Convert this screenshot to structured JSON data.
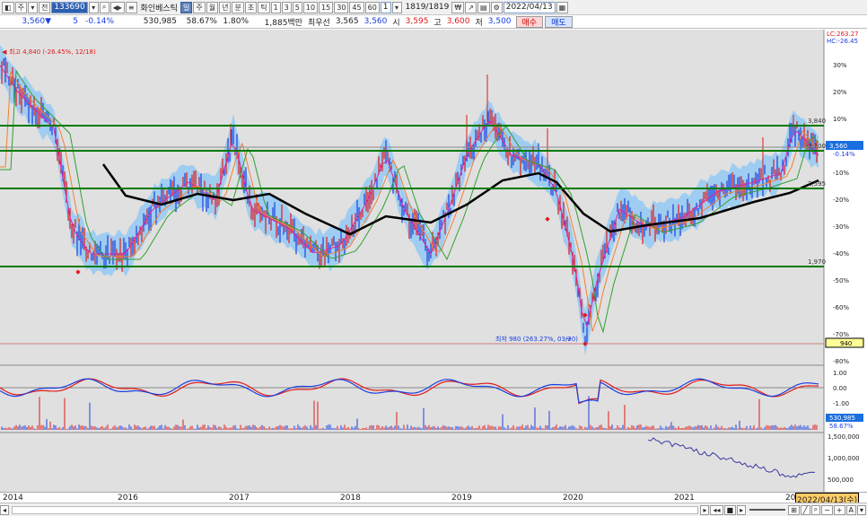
{
  "toolbar1": {
    "btn_a": "주",
    "btn_b": "전",
    "code": "133690",
    "name": "화인베스틱",
    "period_sel": "일",
    "period_week": "주",
    "period_month": "월",
    "period_year": "년",
    "period_min": "분",
    "period_sec": "초",
    "period_tick": "틱",
    "intervals": [
      "1",
      "3",
      "5",
      "10",
      "15",
      "30",
      "45",
      "60"
    ],
    "count": "1",
    "count2": "1819/1819",
    "date": "2022/04/13"
  },
  "quote": {
    "price": "3,560▼",
    "change": "5",
    "change_pct": "-0.14%",
    "volume": "530,985",
    "vol_ratio": "58.67%",
    "turnover": "1.80%",
    "amount": "1,885백만",
    "pref_label": "최우선",
    "ask": "3,565",
    "bid": "3,560",
    "open_label": "시",
    "open": "3,595",
    "high_label": "고",
    "high": "3,600",
    "low_label": "저",
    "low": "3,500",
    "buy_label": "매수",
    "sell_label": "매도"
  },
  "chart": {
    "lc_label": "LC:263.27",
    "hc_label": "HC:-26.45",
    "high_note": "최고 4,840 (-26.45%, 12/18)",
    "low_note": "최저 980 (263.27%, 03/20)",
    "price_lines": [
      "3,840",
      "3,100",
      "2,595",
      "1,970"
    ],
    "current_tag": "3,560",
    "current_pct": "-0.14%",
    "low_tag": "940",
    "pct_ticks": [
      "30%",
      "20%",
      "10%",
      "0%",
      "-10%",
      "-20%",
      "-30%",
      "-40%",
      "-50%",
      "-60%",
      "-70%",
      "-80%"
    ],
    "osc_ticks": [
      "1.00",
      "0.00",
      "-1.00"
    ],
    "vol_tag": "530,985",
    "vol_tag2": "58.67%",
    "sub_ticks": [
      "1,500,000",
      "1,000,000",
      "500,000"
    ],
    "years": [
      "2014",
      "2016",
      "2017",
      "2018",
      "2019",
      "2020",
      "2021",
      "202"
    ],
    "date_tag": "2022/04/13(수)"
  },
  "colors": {
    "up": "#e01a1a",
    "down": "#1a3fe0",
    "band": "#8fc8f5",
    "ma": "#000000",
    "hline": "#007a00"
  }
}
